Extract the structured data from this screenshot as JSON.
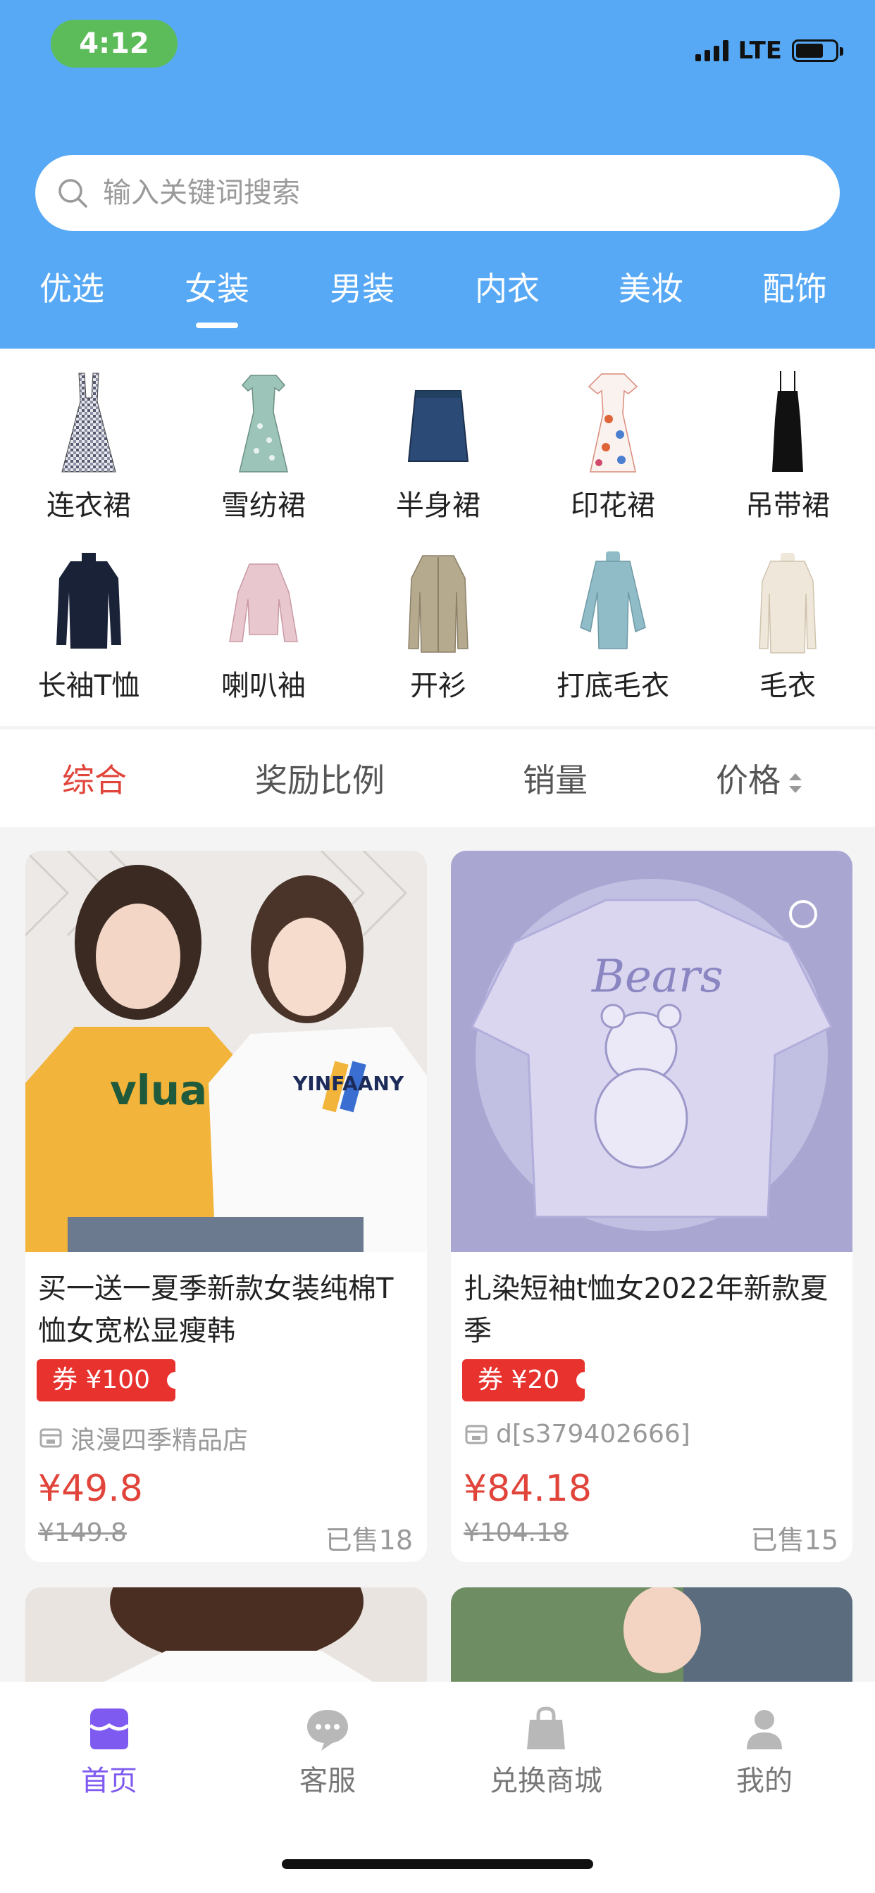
{
  "status_bar": {
    "time": "4:12",
    "network": "LTE"
  },
  "search": {
    "placeholder": "输入关键词搜索"
  },
  "category_tabs": [
    "优选",
    "女装",
    "男装",
    "内衣",
    "美妆",
    "配饰"
  ],
  "active_category": "女装",
  "subcategories": [
    "连衣裙",
    "雪纺裙",
    "半身裙",
    "印花裙",
    "吊带裙",
    "长袖T恤",
    "喇叭袖",
    "开衫",
    "打底毛衣",
    "毛衣"
  ],
  "sort": {
    "overall": "综合",
    "reward": "奖励比例",
    "sales": "销量",
    "price": "价格"
  },
  "products": [
    {
      "title": "买一送一夏季新款女装纯棉T恤女宽松显瘦韩",
      "coupon": "券 ¥100",
      "store": "浪漫四季精品店",
      "price": "¥49.8",
      "original_price": "¥149.8",
      "sold": "已售18",
      "shirt_text_1": "vluae",
      "shirt_text_2": "YINFAANY"
    },
    {
      "title": "扎染短袖t恤女2022年新款夏季",
      "coupon": "券 ¥20",
      "store": "d[s379402666]",
      "price": "¥84.18",
      "original_price": "¥104.18",
      "sold": "已售15",
      "shirt_text_1": "Bears"
    }
  ],
  "tabbar": [
    "首页",
    "客服",
    "兑换商城",
    "我的"
  ],
  "colors": {
    "header": "#57a9f5",
    "accent_red": "#e0443a",
    "tab_active": "#7e5af0"
  }
}
